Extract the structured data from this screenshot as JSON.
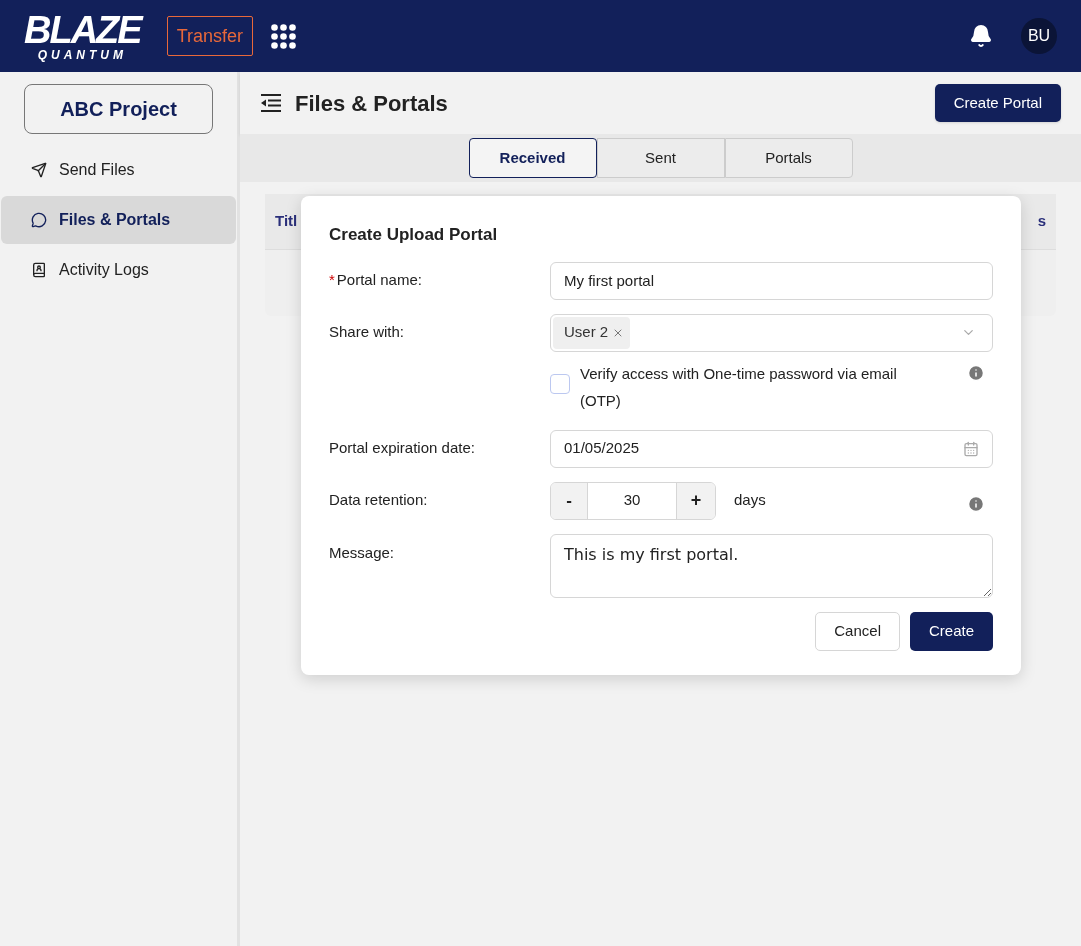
{
  "header": {
    "logo": {
      "word": "BLAZE",
      "subword": "QUANTUM"
    },
    "app_button": "Transfer",
    "user_initials": "BU"
  },
  "sidebar": {
    "project": "ABC Project",
    "items": [
      {
        "label": "Send Files",
        "selected": false
      },
      {
        "label": "Files & Portals",
        "selected": true
      },
      {
        "label": "Activity Logs",
        "selected": false
      }
    ]
  },
  "page": {
    "title": "Files & Portals",
    "action": "Create Portal"
  },
  "tabs": [
    {
      "label": "Received",
      "selected": true
    },
    {
      "label": "Sent",
      "selected": false
    },
    {
      "label": "Portals",
      "selected": false
    }
  ],
  "table": {
    "columns": [
      "Titl",
      "s"
    ]
  },
  "dialog": {
    "title": "Create Upload Portal",
    "portal_name": {
      "required_mark": "*",
      "label": "Portal name:",
      "value": "My first portal"
    },
    "share_with": {
      "label": "Share with:",
      "tags": [
        "User 2"
      ]
    },
    "otp": {
      "label": "Verify access with One-time password via email (OTP)",
      "checked": false
    },
    "expiration": {
      "label": "Portal expiration date:",
      "value": "01/05/2025"
    },
    "retention": {
      "label": "Data retention:",
      "minus": "-",
      "value": "30",
      "plus": "+",
      "unit": "days"
    },
    "message": {
      "label": "Message:",
      "value": "This is my first portal."
    },
    "buttons": {
      "cancel": "Cancel",
      "create": "Create"
    }
  }
}
